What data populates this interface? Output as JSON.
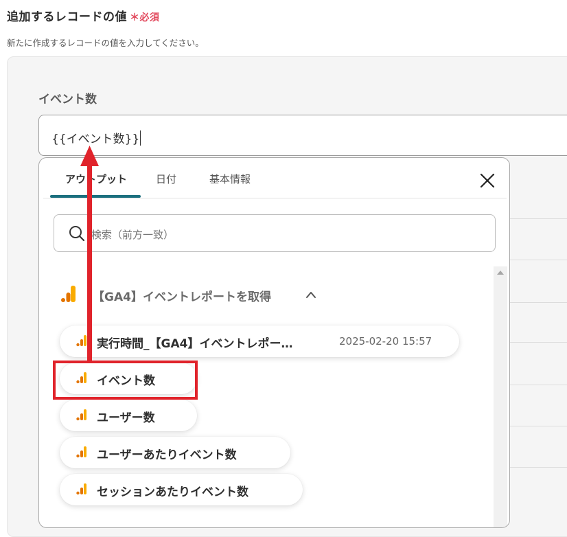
{
  "section": {
    "title": "追加するレコードの値",
    "required_mark": "＊",
    "required_label": "必須",
    "description": "新たに作成するレコードの値を入力してください。"
  },
  "field": {
    "label": "イベント数",
    "value": "{{イベント数}}"
  },
  "dropdown": {
    "tabs": [
      {
        "label": "アウトプット",
        "active": true
      },
      {
        "label": "日付",
        "active": false
      },
      {
        "label": "基本情報",
        "active": false
      }
    ],
    "search_placeholder": "検索（前方一致）",
    "group": {
      "title": "【GA4】イベントレポートを取得",
      "expanded": true,
      "items": [
        {
          "label": "実行時間_【GA4】イベントレポー…",
          "value": "2025-02-20 15:57"
        },
        {
          "label": "イベント数",
          "value": "",
          "highlighted": true
        },
        {
          "label": "ユーザー数",
          "value": ""
        },
        {
          "label": "ユーザーあたりイベント数",
          "value": ""
        },
        {
          "label": "セッションあたりイベント数",
          "value": ""
        }
      ]
    }
  },
  "colors": {
    "accent_tab": "#1b6f7e",
    "required": "#e24a5e",
    "annotation_red": "#e0232b",
    "ga_orange_dark": "#e37400",
    "ga_orange_light": "#f9ab00"
  }
}
